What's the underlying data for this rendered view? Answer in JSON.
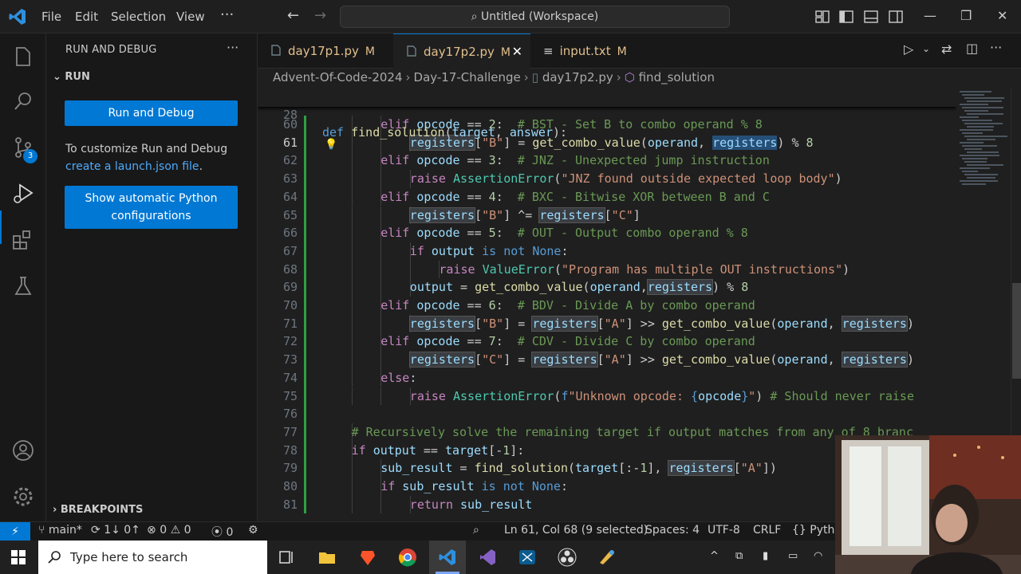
{
  "titlebar": {
    "menu": [
      "File",
      "Edit",
      "Selection",
      "View"
    ],
    "more": "···",
    "search": "Untitled (Workspace)",
    "window_controls": [
      "minimize-icon",
      "restore-icon",
      "close-icon"
    ]
  },
  "activity_bar": {
    "items": [
      "explorer-icon",
      "search-icon",
      "source-control-icon",
      "run-debug-icon",
      "extensions-icon",
      "testing-icon"
    ],
    "source_control_badge": "3",
    "bottom": [
      "accounts-icon",
      "settings-gear-icon"
    ]
  },
  "sidebar": {
    "title": "RUN AND DEBUG",
    "more": "···",
    "section": "RUN",
    "run_button": "Run and Debug",
    "help_text": "To customize Run and Debug",
    "help_link": "create a launch.json file",
    "help_suffix": ".",
    "python_button_line1": "Show automatic Python",
    "python_button_line2": "configurations",
    "breakpoints": "BREAKPOINTS"
  },
  "tabs": [
    {
      "name": "day17p1.py",
      "status": "M",
      "active": false
    },
    {
      "name": "day17p2.py",
      "status": "M",
      "active": true
    },
    {
      "name": "input.txt",
      "status": "M",
      "active": false
    }
  ],
  "breadcrumb": [
    "Advent-Of-Code-2024",
    "Day-17-Challenge",
    "day17p2.py",
    "find_solution"
  ],
  "editor": {
    "sticky_line_number": "28",
    "sticky_code": "def find_solution(target, answer):",
    "current_line": "61",
    "lines": [
      {
        "n": "60",
        "t": "elif opcode == 2:  # BST - Set B to combo operand % 8"
      },
      {
        "n": "61",
        "t": "registers[\"B\"] = get_combo_value(operand, registers) % 8"
      },
      {
        "n": "62",
        "t": "elif opcode == 3:  # JNZ - Unexpected jump instruction"
      },
      {
        "n": "63",
        "t": "raise AssertionError(\"JNZ found outside expected loop body\")"
      },
      {
        "n": "64",
        "t": "elif opcode == 4:  # BXC - Bitwise XOR between B and C"
      },
      {
        "n": "65",
        "t": "registers[\"B\"] ^= registers[\"C\"]"
      },
      {
        "n": "66",
        "t": "elif opcode == 5:  # OUT - Output combo operand % 8"
      },
      {
        "n": "67",
        "t": "if output is not None:"
      },
      {
        "n": "68",
        "t": "raise ValueError(\"Program has multiple OUT instructions\")"
      },
      {
        "n": "69",
        "t": "output = get_combo_value(operand,registers) % 8"
      },
      {
        "n": "70",
        "t": "elif opcode == 6:  # BDV - Divide A by combo operand"
      },
      {
        "n": "71",
        "t": "registers[\"B\"] = registers[\"A\"] >> get_combo_value(operand, registers)"
      },
      {
        "n": "72",
        "t": "elif opcode == 7:  # CDV - Divide C by combo operand"
      },
      {
        "n": "73",
        "t": "registers[\"C\"] = registers[\"A\"] >> get_combo_value(operand, registers)"
      },
      {
        "n": "74",
        "t": "else:"
      },
      {
        "n": "75",
        "t": "raise AssertionError(f\"Unknown opcode: {opcode}\") # Should never raise"
      },
      {
        "n": "76",
        "t": ""
      },
      {
        "n": "77",
        "t": "# Recursively solve the remaining target if output matches from any of 8 branc"
      },
      {
        "n": "78",
        "t": "if output == target[-1]:"
      },
      {
        "n": "79",
        "t": "sub_result = find_solution(target[:-1], registers[\"A\"])"
      },
      {
        "n": "80",
        "t": "if sub_result is not None:"
      },
      {
        "n": "81",
        "t": "return sub_result"
      }
    ]
  },
  "statusbar": {
    "branch": "main*",
    "sync": "1↓ 0↑",
    "errors": "0",
    "warnings": "0",
    "ports": "0",
    "position": "Ln 61, Col 68 (9 selected)",
    "spaces": "Spaces: 4",
    "encoding": "UTF-8",
    "eol": "CRLF",
    "language": "Pytho"
  },
  "taskbar": {
    "search_placeholder": "Type here to search",
    "apps": [
      "task-view-icon",
      "file-explorer-icon",
      "brave-icon",
      "chrome-icon",
      "vscode-icon",
      "visual-studio-icon",
      "snipping-icon",
      "obs-icon",
      "paint-icon"
    ]
  },
  "colors": {
    "accent": "#0078d4",
    "modified": "#e2c08d",
    "keyword": "#569cd6",
    "control": "#c586c0",
    "function": "#dcdcaa",
    "variable": "#9cdcfe",
    "string": "#ce9178",
    "comment": "#6a9955"
  }
}
